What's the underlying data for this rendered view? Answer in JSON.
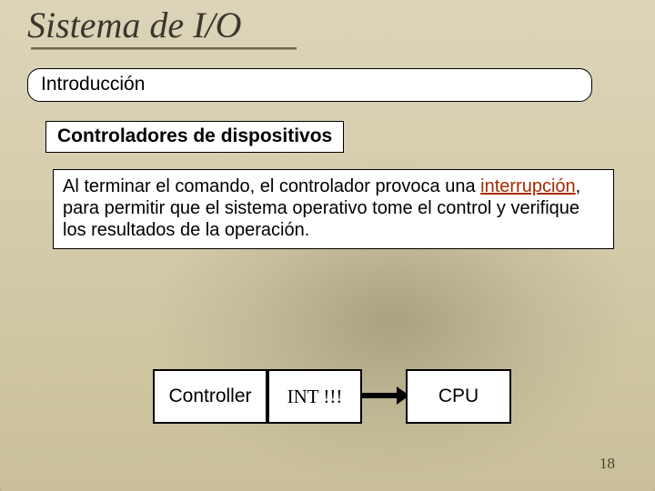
{
  "title": "Sistema de I/O",
  "section": "Introducción",
  "subheading": "Controladores de dispositivos",
  "body": {
    "pre": "Al terminar el comando, el controlador provoca una ",
    "emph": "interrupción",
    "post": ", para permitir que el sistema operativo tome el control y verifique los resultados de la operación."
  },
  "diagram": {
    "controller": "Controller",
    "int": "INT !!!",
    "cpu": "CPU"
  },
  "page_number": "18"
}
